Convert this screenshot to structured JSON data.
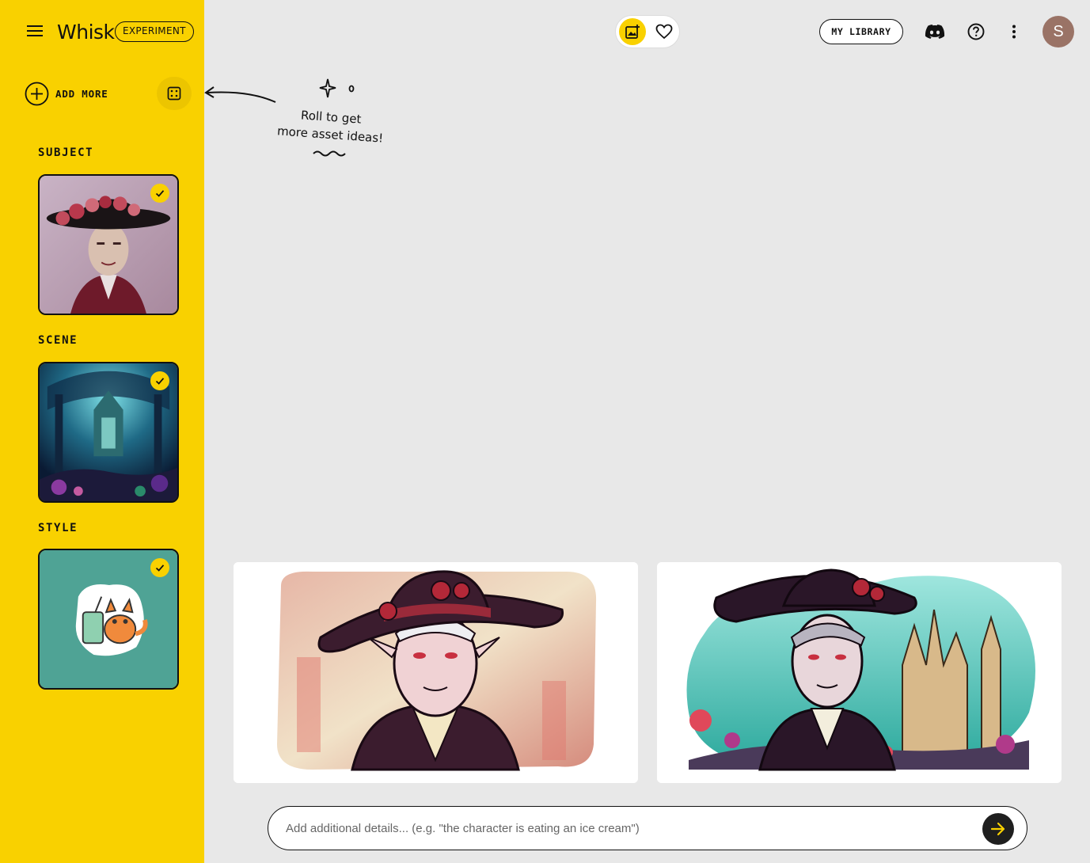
{
  "app": {
    "logo": "Whisk",
    "badge": "EXPERIMENT"
  },
  "sidebar": {
    "add_more_label": "ADD MORE",
    "sections": [
      {
        "title": "SUBJECT",
        "selected": true
      },
      {
        "title": "SCENE",
        "selected": true
      },
      {
        "title": "STYLE",
        "selected": true
      }
    ]
  },
  "hint": {
    "line1": "Roll to get",
    "line2": "more asset ideas!"
  },
  "topbar": {
    "library_label": "MY LIBRARY",
    "avatar_initial": "S",
    "icons": [
      "add-image-icon",
      "heart-icon",
      "discord-icon",
      "help-icon",
      "more-vert-icon"
    ]
  },
  "prompt": {
    "placeholder": "Add additional details... (e.g. \"the character is eating an ice cream\")",
    "value": ""
  },
  "colors": {
    "sidebar": "#f9d100",
    "background": "#e8e8e8",
    "accent_dark": "#1f1f1f",
    "avatar": "#9a7366"
  }
}
